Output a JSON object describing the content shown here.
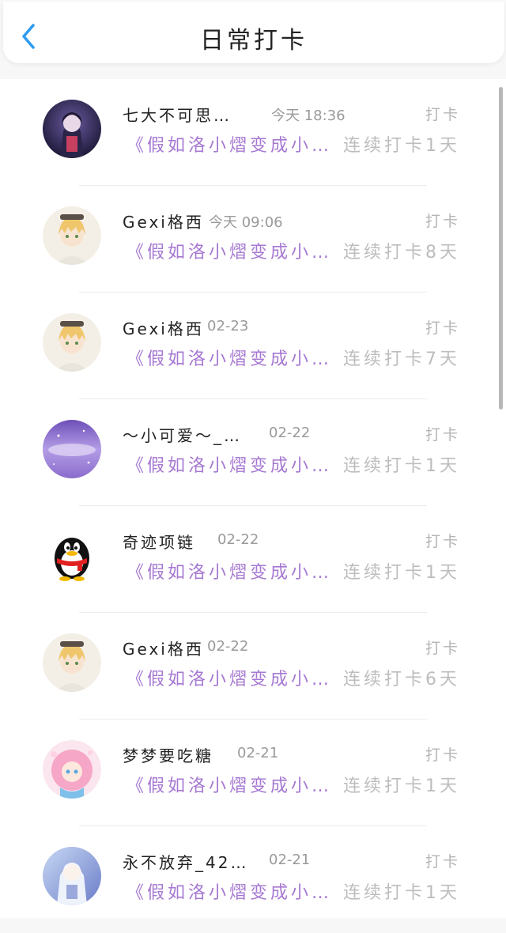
{
  "header": {
    "title": "日常打卡",
    "back_icon": "chevron-left-icon",
    "accent_color": "#2e9bf0"
  },
  "entries": [
    {
      "name": "七大不可思…",
      "time": "今天 18:36",
      "tag": "打卡",
      "group": "《假如洛小熠变成小…",
      "streak": "连续打卡1天",
      "avatar": "dark-anime-avatar"
    },
    {
      "name": "Gexi格西",
      "time": "今天 09:06",
      "tag": "打卡",
      "group": "《假如洛小熠变成小…",
      "streak": "连续打卡8天",
      "avatar": "blonde-anime-avatar"
    },
    {
      "name": "Gexi格西",
      "time": "02-23",
      "tag": "打卡",
      "group": "《假如洛小熠变成小…",
      "streak": "连续打卡7天",
      "avatar": "blonde-anime-avatar"
    },
    {
      "name": "～小可爱～_…",
      "time": "02-22",
      "tag": "打卡",
      "group": "《假如洛小熠变成小…",
      "streak": "连续打卡1天",
      "avatar": "purple-galaxy-avatar"
    },
    {
      "name": "奇迹项链",
      "time": "02-22",
      "tag": "打卡",
      "group": "《假如洛小熠变成小…",
      "streak": "连续打卡1天",
      "avatar": "qq-penguin-avatar"
    },
    {
      "name": "Gexi格西",
      "time": "02-22",
      "tag": "打卡",
      "group": "《假如洛小熠变成小…",
      "streak": "连续打卡6天",
      "avatar": "blonde-anime-avatar"
    },
    {
      "name": "梦梦要吃糖",
      "time": "02-21",
      "tag": "打卡",
      "group": "《假如洛小熠变成小…",
      "streak": "连续打卡1天",
      "avatar": "pink-anime-avatar"
    },
    {
      "name": "永不放弃_42…",
      "time": "02-21",
      "tag": "打卡",
      "group": "《假如洛小熠变成小…",
      "streak": "连续打卡1天",
      "avatar": "white-anime-avatar"
    }
  ],
  "colors": {
    "group_text": "#a678d2",
    "streak_text": "#bdbdbd",
    "name_text": "#222222",
    "time_text": "#9a9a9a"
  }
}
